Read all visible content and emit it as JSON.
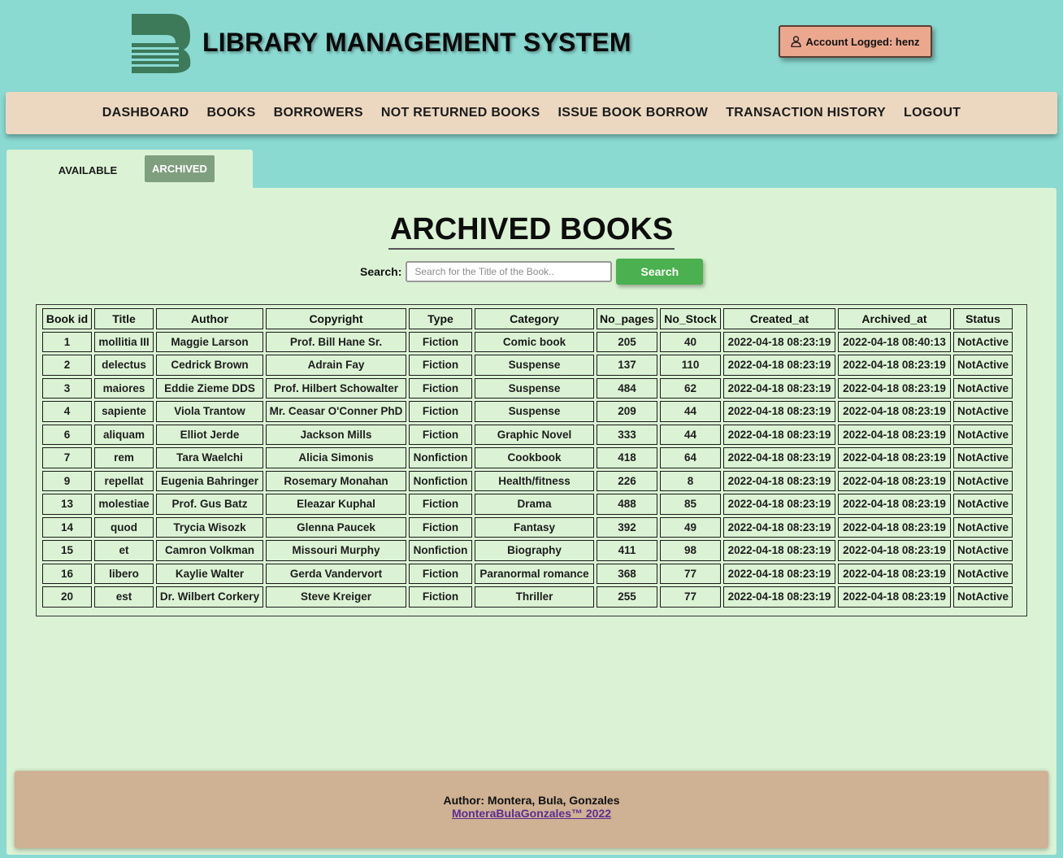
{
  "header": {
    "title": "LIBRARY MANAGEMENT SYSTEM",
    "logo_icon": "book-logo-icon",
    "logo_color": "#3d7a5a",
    "account_label": "Account Logged: henz",
    "account_icon": "user-icon"
  },
  "nav": {
    "items": [
      {
        "label": "DASHBOARD"
      },
      {
        "label": "BOOKS"
      },
      {
        "label": "BORROWERS"
      },
      {
        "label": "NOT RETURNED BOOKS"
      },
      {
        "label": "ISSUE BOOK BORROW"
      },
      {
        "label": "TRANSACTION HISTORY"
      },
      {
        "label": "LOGOUT"
      }
    ]
  },
  "tabs": {
    "available": "AVAILABLE",
    "archived": "ARCHIVED",
    "active": "archived"
  },
  "main": {
    "title": "ARCHIVED BOOKS",
    "search_label": "Search:",
    "search_placeholder": "Search for the Title of the Book..",
    "search_value": "",
    "search_button": "Search"
  },
  "table": {
    "columns": [
      "Book id",
      "Title",
      "Author",
      "Copyright",
      "Type",
      "Category",
      "No_pages",
      "No_Stock",
      "Created_at",
      "Archived_at",
      "Status"
    ],
    "rows": [
      [
        "1",
        "mollitia III",
        "Maggie Larson",
        "Prof. Bill Hane Sr.",
        "Fiction",
        "Comic book",
        "205",
        "40",
        "2022-04-18 08:23:19",
        "2022-04-18 08:40:13",
        "NotActive"
      ],
      [
        "2",
        "delectus",
        "Cedrick Brown",
        "Adrain Fay",
        "Fiction",
        "Suspense",
        "137",
        "110",
        "2022-04-18 08:23:19",
        "2022-04-18 08:23:19",
        "NotActive"
      ],
      [
        "3",
        "maiores",
        "Eddie Zieme DDS",
        "Prof. Hilbert Schowalter",
        "Fiction",
        "Suspense",
        "484",
        "62",
        "2022-04-18 08:23:19",
        "2022-04-18 08:23:19",
        "NotActive"
      ],
      [
        "4",
        "sapiente",
        "Viola Trantow",
        "Mr. Ceasar O'Conner PhD",
        "Fiction",
        "Suspense",
        "209",
        "44",
        "2022-04-18 08:23:19",
        "2022-04-18 08:23:19",
        "NotActive"
      ],
      [
        "6",
        "aliquam",
        "Elliot Jerde",
        "Jackson Mills",
        "Fiction",
        "Graphic Novel",
        "333",
        "44",
        "2022-04-18 08:23:19",
        "2022-04-18 08:23:19",
        "NotActive"
      ],
      [
        "7",
        "rem",
        "Tara Waelchi",
        "Alicia Simonis",
        "Nonfiction",
        "Cookbook",
        "418",
        "64",
        "2022-04-18 08:23:19",
        "2022-04-18 08:23:19",
        "NotActive"
      ],
      [
        "9",
        "repellat",
        "Eugenia Bahringer",
        "Rosemary Monahan",
        "Nonfiction",
        "Health/fitness",
        "226",
        "8",
        "2022-04-18 08:23:19",
        "2022-04-18 08:23:19",
        "NotActive"
      ],
      [
        "13",
        "molestiae",
        "Prof. Gus Batz",
        "Eleazar Kuphal",
        "Fiction",
        "Drama",
        "488",
        "85",
        "2022-04-18 08:23:19",
        "2022-04-18 08:23:19",
        "NotActive"
      ],
      [
        "14",
        "quod",
        "Trycia Wisozk",
        "Glenna Paucek",
        "Fiction",
        "Fantasy",
        "392",
        "49",
        "2022-04-18 08:23:19",
        "2022-04-18 08:23:19",
        "NotActive"
      ],
      [
        "15",
        "et",
        "Camron Volkman",
        "Missouri Murphy",
        "Nonfiction",
        "Biography",
        "411",
        "98",
        "2022-04-18 08:23:19",
        "2022-04-18 08:23:19",
        "NotActive"
      ],
      [
        "16",
        "libero",
        "Kaylie Walter",
        "Gerda Vandervort",
        "Fiction",
        "Paranormal romance",
        "368",
        "77",
        "2022-04-18 08:23:19",
        "2022-04-18 08:23:19",
        "NotActive"
      ],
      [
        "20",
        "est",
        "Dr. Wilbert Corkery",
        "Steve Kreiger",
        "Fiction",
        "Thriller",
        "255",
        "77",
        "2022-04-18 08:23:19",
        "2022-04-18 08:23:19",
        "NotActive"
      ]
    ]
  },
  "footer": {
    "author": "Author: Montera, Bula, Gonzales",
    "link": "MonteraBulaGonzales™ 2022"
  },
  "colors": {
    "page_bg": "#8adad2",
    "nav_bg": "#ecd8c0",
    "panel_bg": "#dbf3d4",
    "active_tab": "#7f9f7f",
    "search_button": "#4bb04f",
    "account_button": "#eba88f",
    "footer_bg": "#cfb193",
    "footer_link": "#5b2d91"
  }
}
